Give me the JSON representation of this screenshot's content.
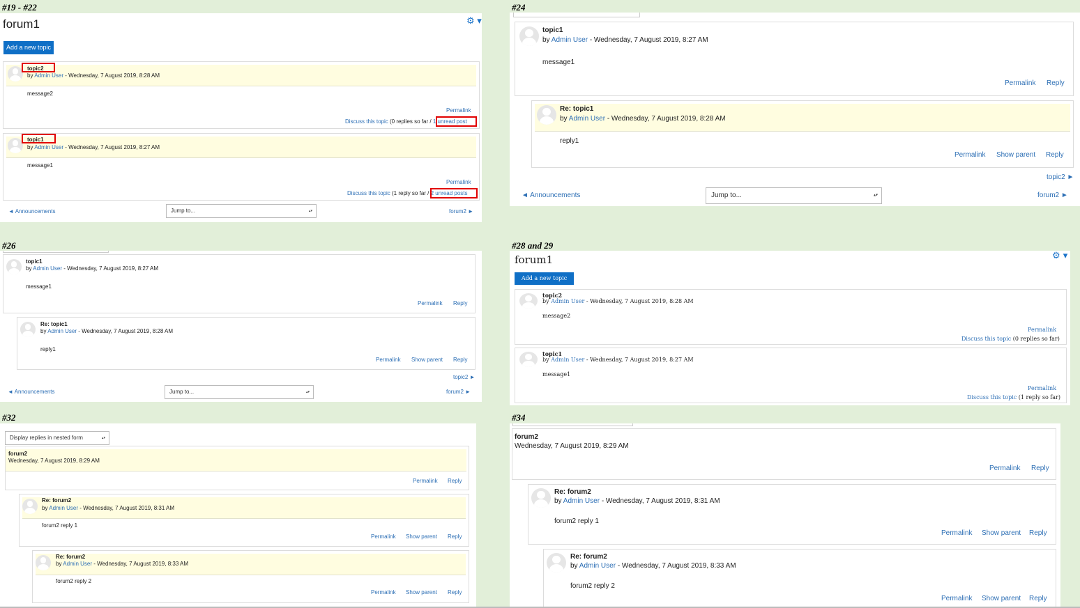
{
  "labels": {
    "p1": "#19 - #22",
    "p2": "#24",
    "p3": "#26",
    "p4": "#28 and 29",
    "p5": "#32",
    "p6": "#34"
  },
  "common": {
    "forum_title": "forum1",
    "add_topic": "Add a new topic",
    "by": "by",
    "author": "Admin User",
    "permalink": "Permalink",
    "reply": "Reply",
    "show_parent": "Show parent",
    "discuss": "Discuss this topic",
    "jump_to": "Jump to...",
    "prev_forum": "◄ Announcements",
    "next_forum": "forum2 ►",
    "next_topic": "topic2 ►",
    "display_mode": "Display replies in nested form",
    "gear_icon": "⚙ ▾",
    "select_arrow": "▴▾"
  },
  "posts": {
    "topic2": {
      "subject": "topic2",
      "date": " - Wednesday, 7 August 2019, 8:28 AM",
      "message": "message2"
    },
    "topic1": {
      "subject": "topic1",
      "date": " - Wednesday, 7 August 2019, 8:27 AM",
      "message": "message1"
    },
    "re_topic1": {
      "subject": "Re: topic1",
      "date": " - Wednesday, 7 August 2019, 8:28 AM",
      "message": "reply1"
    },
    "forum2": {
      "subject": "forum2",
      "date": "Wednesday, 7 August 2019, 8:29 AM"
    },
    "re_forum2_1": {
      "subject": "Re: forum2",
      "date": " - Wednesday, 7 August 2019, 8:31 AM",
      "message": "forum2 reply 1"
    },
    "re_forum2_2": {
      "subject": "Re: forum2",
      "date": " - Wednesday, 7 August 2019, 8:33 AM",
      "message": "forum2 reply 2"
    }
  },
  "discussion_status": {
    "topic2_unread": {
      "text": " (0 replies so far / ",
      "link": "1 unread post"
    },
    "topic1_unread": {
      "text": " (1 reply so far / ",
      "link": "2 unread posts"
    },
    "topic2_plain": {
      "text": " (0 replies so far)"
    },
    "topic1_plain": {
      "text": " (1 reply so far)"
    }
  }
}
